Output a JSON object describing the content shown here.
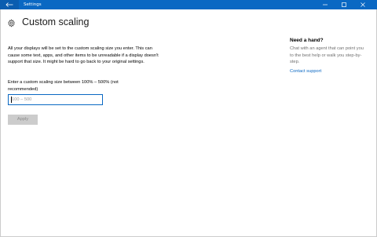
{
  "window": {
    "title": "Settings",
    "accent": "#0a68c3",
    "back_icon": "back-arrow-icon",
    "controls": [
      "minimize-icon",
      "maximize-icon",
      "close-icon"
    ]
  },
  "page": {
    "icon": "gear-icon",
    "title": "Custom scaling",
    "description": "All your displays will be set to the custom scaling size you enter. This can cause some text, apps, and other items to be unreadable if a display doesn't support that size. It might be hard to go back to your original settings.",
    "prompt": "Enter a custom scaling size between 100% – 500% (not recommended)",
    "input_placeholder": "100 – 500",
    "apply_label": "Apply"
  },
  "help": {
    "title": "Need a hand?",
    "text": "Chat with an agent that can point you to the best help or walk you step-by-step.",
    "link": "Contact support"
  }
}
